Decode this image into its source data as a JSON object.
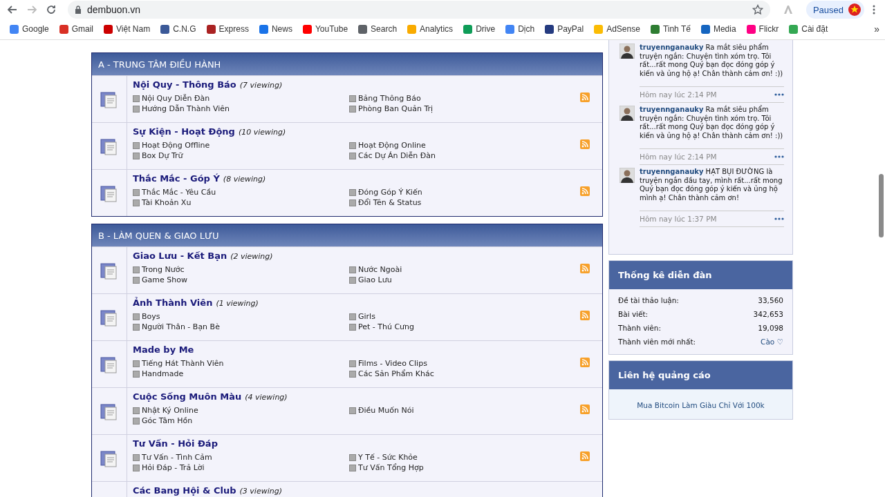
{
  "browser": {
    "url": "dembuon.vn",
    "profile": "Paused",
    "bookmarks": [
      "Google",
      "Gmail",
      "Việt Nam",
      "C.N.G",
      "Express",
      "News",
      "YouTube",
      "Search",
      "Analytics",
      "Drive",
      "Dịch",
      "PayPal",
      "AdSense",
      "Tinh Tế",
      "Media",
      "Flickr",
      "Cài đặt"
    ],
    "more": "»"
  },
  "categories": [
    {
      "title": "A - TRUNG TÂM ĐIỀU HÀNH",
      "forums": [
        {
          "name": "Nội Quy - Thông Báo",
          "viewing": "(7 viewing)",
          "subforums": [
            "Nội Quy Diễn Đàn",
            "Bảng Thông Báo",
            "Hướng Dẫn Thành Viên",
            "Phòng Ban Quản Trị"
          ]
        },
        {
          "name": "Sự Kiện - Hoạt Động",
          "viewing": "(10 viewing)",
          "subforums": [
            "Hoạt Động Offline",
            "Hoạt Động Online",
            "Box Dự Trữ",
            "Các Dự Án Diễn Đàn"
          ]
        },
        {
          "name": "Thắc Mắc - Góp Ý",
          "viewing": "(8 viewing)",
          "subforums": [
            "Thắc Mắc - Yêu Cầu",
            "Đóng Góp Ý Kiến",
            "Tài Khoản Xu",
            "Đổi Tên & Status"
          ]
        }
      ]
    },
    {
      "title": "B - LÀM QUEN & GIAO LƯU",
      "forums": [
        {
          "name": "Giao Lưu - Kết Bạn",
          "viewing": "(2 viewing)",
          "subforums": [
            "Trong Nước",
            "Nước Ngoài",
            "Game Show",
            "Giao Lưu"
          ]
        },
        {
          "name": "Ảnh Thành Viên",
          "viewing": "(1 viewing)",
          "subforums": [
            "Boys",
            "Girls",
            "Người Thân - Bạn Bè",
            "Pet - Thú Cưng"
          ]
        },
        {
          "name": "Made by Me",
          "subforums": [
            "Tiếng Hát Thành Viên",
            "Films - Video Clips",
            "Handmade",
            "Các Sản Phẩm Khác"
          ]
        },
        {
          "name": "Cuộc Sống Muôn Màu",
          "viewing": "(4 viewing)",
          "subforums": [
            "Nhật Ký Online",
            "Điều Muốn Nói",
            "Góc Tâm Hồn"
          ]
        },
        {
          "name": "Tư Vấn - Hỏi Đáp",
          "subforums": [
            "Tư Vấn - Tình Cảm",
            "Y Tế - Sức Khỏe",
            "Hỏi Đáp - Trả Lời",
            "Tư Vấn Tổng Hợp"
          ]
        },
        {
          "name": "Các Bang Hội & Club",
          "viewing": "(3 viewing)"
        }
      ]
    }
  ],
  "shouts": [
    {
      "user": "truyennganauky",
      "text": "Ra mắt siêu phẩm truyện ngắn: Chuyện tình xóm trọ. Tôi rất...rất mong Quý bạn đọc đóng góp ý kiến và ủng hộ ạ! Chân thành cảm ơn! :))",
      "time": "Hôm nay lúc 2:14 PM"
    },
    {
      "user": "truyennganauky",
      "text": "Ra mắt siêu phẩm truyện ngắn: Chuyện tình xóm trọ. Tôi rất...rất mong Quý bạn đọc đóng góp ý kiến và ủng hộ ạ! Chân thành cảm ơn! :))",
      "time": "Hôm nay lúc 2:14 PM"
    },
    {
      "user": "truyennganauky",
      "text": "HẠT BỤI ĐƯỜNG là truyện ngắn đầu tay, mình rất...rất mong Quý bạn đọc đóng góp ý kiến và ủng hộ mình ạ! Chân thành cảm ơn!",
      "time": "Hôm nay lúc 1:37 PM"
    }
  ],
  "stats": {
    "title": "Thống kê diễn đàn",
    "rows": [
      {
        "label": "Đề tài thảo luận:",
        "value": "33,560"
      },
      {
        "label": "Bài viết:",
        "value": "342,653"
      },
      {
        "label": "Thành viên:",
        "value": "19,098"
      },
      {
        "label": "Thành viên mới nhất:",
        "value": "Cào ♡",
        "kind": "link"
      }
    ]
  },
  "ads": {
    "title": "Liên hệ quảng cáo",
    "link": "Mua Bitcoin Làm Giàu Chỉ Với 100k"
  }
}
